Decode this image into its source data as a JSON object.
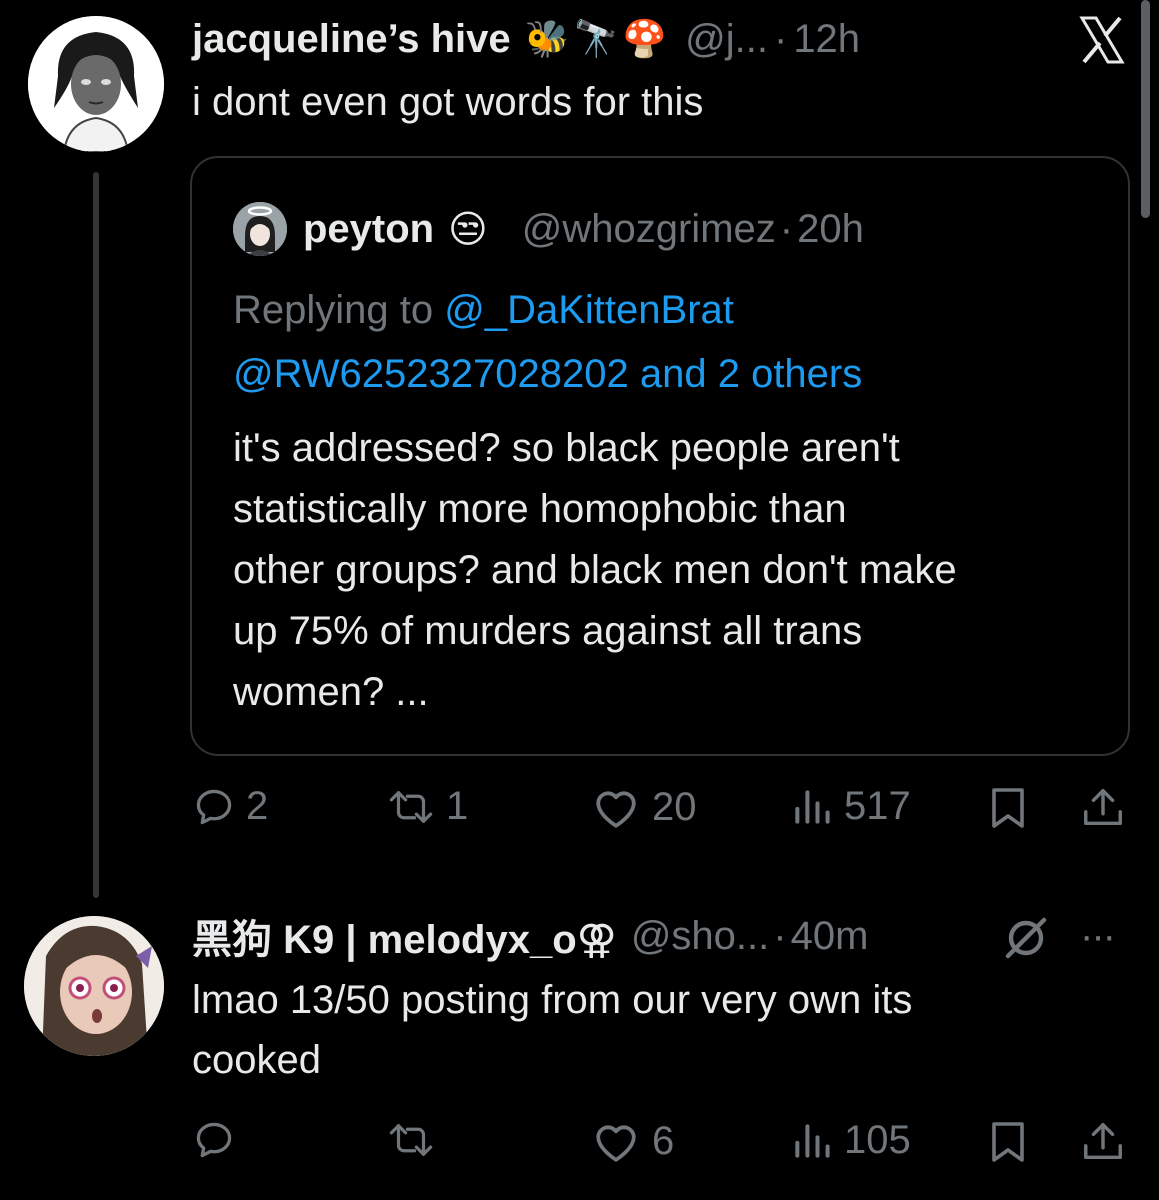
{
  "tweet1": {
    "name": "jacqueline’s hive",
    "emojis": "🐝🔭🍄",
    "handle": "@j...",
    "separator": "·",
    "time": "12h",
    "text": "i dont even got words for this",
    "stats": {
      "replies": "2",
      "reposts": "1",
      "likes": "20",
      "views": "517"
    }
  },
  "quote": {
    "name": "peyton",
    "emoji": "😒",
    "handle": "@whozgrimez",
    "separator": "·",
    "time": "20h",
    "replying_prefix": "Replying to",
    "replying_user1": "@_DaKittenBrat",
    "replying_user2": "@RW6252327028202",
    "replying_others": "and 2 others",
    "text_lines": [
      "it's addressed? so black people aren't",
      "statistically more homophobic than",
      "other groups? and black men don't make",
      "up 75% of murders against all trans",
      "women? ..."
    ]
  },
  "tweet2": {
    "name": "黑狗 K9 | melodyx_o⚢",
    "handle": "@sho...",
    "separator": "·",
    "time": "40m",
    "text_lines": [
      "lmao 13/50 posting from our very own its",
      "cooked"
    ],
    "stats": {
      "likes": "6",
      "views": "105"
    }
  },
  "ui": {
    "logo": "X",
    "more_dots": "···",
    "icons": [
      "reply-icon",
      "repost-icon",
      "like-icon",
      "views-icon",
      "bookmark-icon",
      "share-icon",
      "block-icon",
      "x-logo-icon",
      "more-icon"
    ]
  },
  "colors": {
    "background": "#000000",
    "text": "#e7e9ea",
    "muted": "#71767b",
    "link": "#1d9bf0",
    "border": "#2f3336"
  }
}
